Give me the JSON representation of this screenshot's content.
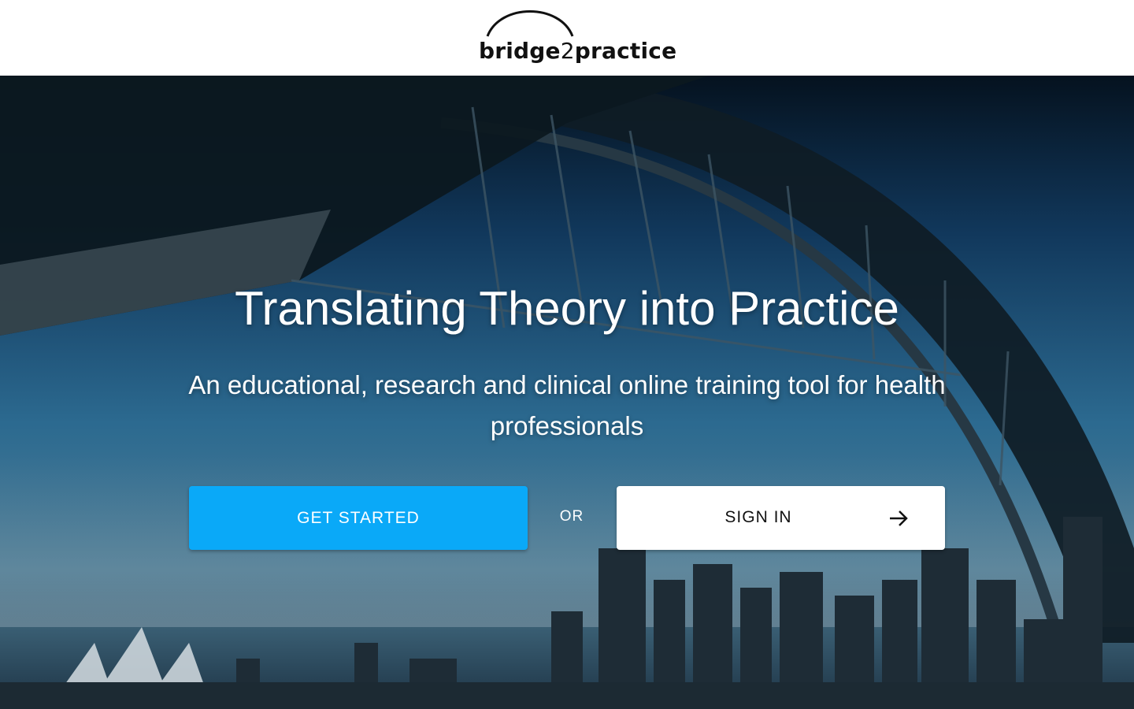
{
  "header": {
    "logo_text_part1": "bridge",
    "logo_text_part2": "2",
    "logo_text_part3": "practice"
  },
  "hero": {
    "headline": "Translating Theory into Practice",
    "subheadline": "An educational, research and clinical online training tool for health professionals",
    "background_image": "Sydney Harbour Bridge and city skyline photo",
    "get_started_label": "GET STARTED",
    "or_label": "OR",
    "sign_in_label": "SIGN IN",
    "sign_in_icon": "arrow-right-icon"
  },
  "colors": {
    "primary_button": "#0aa9f8",
    "secondary_button": "#ffffff",
    "header_background": "#ffffff",
    "text_light": "#ffffff",
    "text_dark": "#111111"
  }
}
